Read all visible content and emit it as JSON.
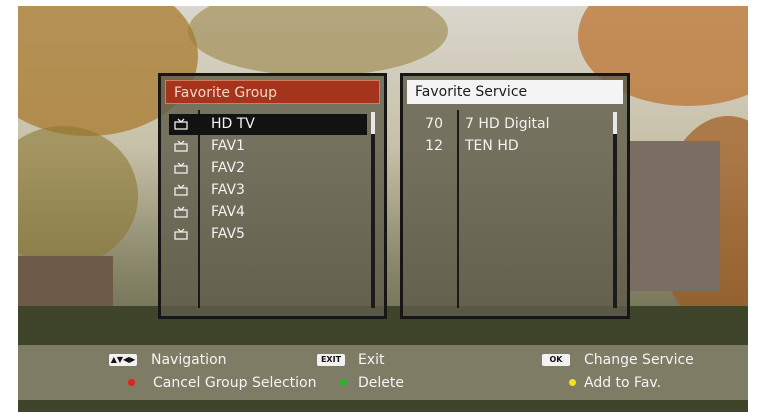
{
  "group_panel": {
    "title": "Favorite Group",
    "items": [
      {
        "label": "HD TV",
        "icon": "tv-icon"
      },
      {
        "label": "FAV1",
        "icon": "tv-icon"
      },
      {
        "label": "FAV2",
        "icon": "tv-icon"
      },
      {
        "label": "FAV3",
        "icon": "tv-icon"
      },
      {
        "label": "FAV4",
        "icon": "tv-icon"
      },
      {
        "label": "FAV5",
        "icon": "tv-icon"
      }
    ],
    "selected_index": 0
  },
  "service_panel": {
    "title": "Favorite Service",
    "items": [
      {
        "number": "70",
        "name": "7 HD Digital"
      },
      {
        "number": "12",
        "name": "TEN HD"
      }
    ]
  },
  "footer": {
    "navigation": {
      "key": "▲▼◀▶",
      "label": "Navigation"
    },
    "exit": {
      "key": "EXIT",
      "label": "Exit"
    },
    "change_service": {
      "key": "OK",
      "label": "Change Service"
    },
    "cancel_group": {
      "color": "#e0231f",
      "label": "Cancel Group Selection"
    },
    "delete": {
      "color": "#27b52a",
      "label": "Delete"
    },
    "add_fav": {
      "color": "#f2e023",
      "label": "Add to Fav."
    }
  }
}
